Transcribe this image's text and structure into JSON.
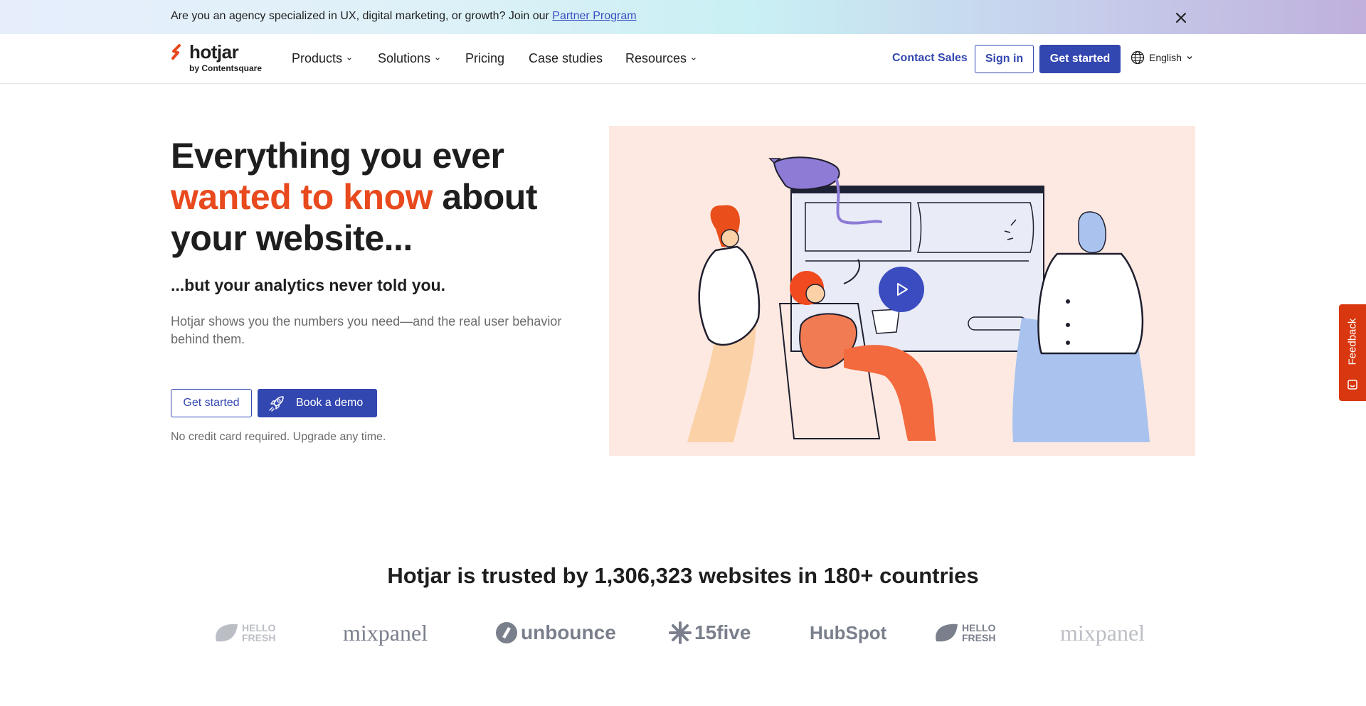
{
  "banner": {
    "text": "Are you an agency specialized in UX, digital marketing, or growth? Join our ",
    "link": "Partner Program"
  },
  "nav": {
    "logo_word": "hotjar",
    "logo_sub": "by Contentsquare",
    "items": [
      {
        "label": "Products",
        "dropdown": true
      },
      {
        "label": "Solutions",
        "dropdown": true
      },
      {
        "label": "Pricing",
        "dropdown": false
      },
      {
        "label": "Case studies",
        "dropdown": false
      },
      {
        "label": "Resources",
        "dropdown": true
      }
    ],
    "contact": "Contact Sales",
    "sign_in": "Sign in",
    "get_started": "Get started",
    "language": "English"
  },
  "hero": {
    "title_1": "Everything you ever",
    "title_highlight": "wanted to know",
    "title_2": "about",
    "title_3": "your website...",
    "subtitle": "...but your analytics never told you.",
    "body": "Hotjar shows you the numbers you need—and the real user behavior behind them.",
    "cta_primary": "Get started",
    "cta_demo": "Book a demo",
    "note": "No credit card required. Upgrade any time."
  },
  "feedback": {
    "label": "Feedback"
  },
  "trust": {
    "title": "Hotjar is trusted by 1,306,323 websites in 180+ countries",
    "logos": [
      {
        "name": "HELLO FRESH",
        "icon": "hellofresh-logo"
      },
      {
        "name": "mixpanel",
        "icon": "mixpanel-logo"
      },
      {
        "name": "unbounce",
        "icon": "unbounce-logo"
      },
      {
        "name": "15five",
        "icon": "15five-logo"
      },
      {
        "name": "HubSpot",
        "icon": "hubspot-logo"
      },
      {
        "name": "HELLO FRESH",
        "icon": "hellofresh-logo"
      },
      {
        "name": "mixpanel",
        "icon": "mixpanel-logo"
      }
    ]
  },
  "colors": {
    "brand_blue": "#3347b0",
    "accent_orange": "#e8491d",
    "illustration_bg": "#fde9e2",
    "feedback_red": "#d9370f"
  }
}
